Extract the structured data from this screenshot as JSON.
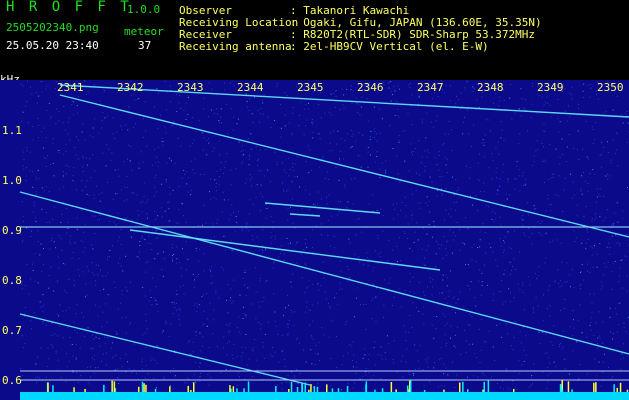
{
  "header": {
    "app_name": "H R O F F T",
    "version": "1.0.0",
    "filename": "2505202340.png",
    "meteor_label": "meteor",
    "datetime": "25.05.20 23:40",
    "meteor_count": "37"
  },
  "info": {
    "observer_label": "Observer",
    "observer_value": ": Takanori Kawachi",
    "location_label": "Receiving Location",
    "location_value": ": Ogaki, Gifu, JAPAN (136.60E, 35.35N)",
    "receiver_label": "Receiver",
    "receiver_value": ": R820T2(RTL-SDR) SDR-Sharp 53.372MHz",
    "antenna_label": "Receiving antenna",
    "antenna_value": ": 2el-HB9CV Vertical (el. E-W)"
  },
  "axis": {
    "unit": "kHz",
    "freq_ticks": [
      "1.1",
      "1.0",
      "0.9",
      "0.8",
      "0.7",
      "0.6"
    ],
    "minute_ticks": [
      "2341",
      "2342",
      "2343",
      "2344",
      "2345",
      "2346",
      "2347",
      "2348",
      "2349",
      "2350"
    ]
  },
  "colors": {
    "background": "#0a0a8a",
    "noise": "#2a4cff",
    "trace": "#66eeff",
    "baseline": "#00e5ff"
  }
}
